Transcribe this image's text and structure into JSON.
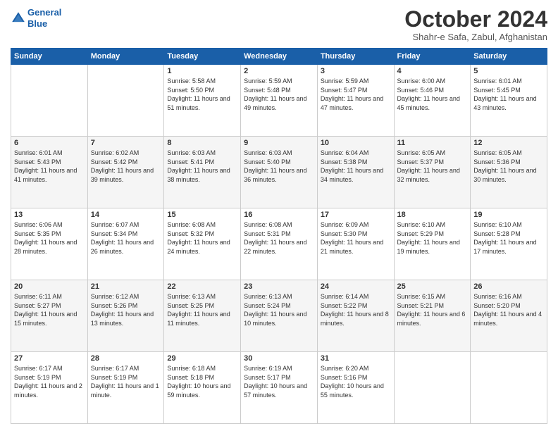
{
  "logo": {
    "line1": "General",
    "line2": "Blue"
  },
  "title": "October 2024",
  "location": "Shahr-e Safa, Zabul, Afghanistan",
  "days_header": [
    "Sunday",
    "Monday",
    "Tuesday",
    "Wednesday",
    "Thursday",
    "Friday",
    "Saturday"
  ],
  "weeks": [
    [
      {
        "num": "",
        "info": ""
      },
      {
        "num": "",
        "info": ""
      },
      {
        "num": "1",
        "info": "Sunrise: 5:58 AM\nSunset: 5:50 PM\nDaylight: 11 hours and 51 minutes."
      },
      {
        "num": "2",
        "info": "Sunrise: 5:59 AM\nSunset: 5:48 PM\nDaylight: 11 hours and 49 minutes."
      },
      {
        "num": "3",
        "info": "Sunrise: 5:59 AM\nSunset: 5:47 PM\nDaylight: 11 hours and 47 minutes."
      },
      {
        "num": "4",
        "info": "Sunrise: 6:00 AM\nSunset: 5:46 PM\nDaylight: 11 hours and 45 minutes."
      },
      {
        "num": "5",
        "info": "Sunrise: 6:01 AM\nSunset: 5:45 PM\nDaylight: 11 hours and 43 minutes."
      }
    ],
    [
      {
        "num": "6",
        "info": "Sunrise: 6:01 AM\nSunset: 5:43 PM\nDaylight: 11 hours and 41 minutes."
      },
      {
        "num": "7",
        "info": "Sunrise: 6:02 AM\nSunset: 5:42 PM\nDaylight: 11 hours and 39 minutes."
      },
      {
        "num": "8",
        "info": "Sunrise: 6:03 AM\nSunset: 5:41 PM\nDaylight: 11 hours and 38 minutes."
      },
      {
        "num": "9",
        "info": "Sunrise: 6:03 AM\nSunset: 5:40 PM\nDaylight: 11 hours and 36 minutes."
      },
      {
        "num": "10",
        "info": "Sunrise: 6:04 AM\nSunset: 5:38 PM\nDaylight: 11 hours and 34 minutes."
      },
      {
        "num": "11",
        "info": "Sunrise: 6:05 AM\nSunset: 5:37 PM\nDaylight: 11 hours and 32 minutes."
      },
      {
        "num": "12",
        "info": "Sunrise: 6:05 AM\nSunset: 5:36 PM\nDaylight: 11 hours and 30 minutes."
      }
    ],
    [
      {
        "num": "13",
        "info": "Sunrise: 6:06 AM\nSunset: 5:35 PM\nDaylight: 11 hours and 28 minutes."
      },
      {
        "num": "14",
        "info": "Sunrise: 6:07 AM\nSunset: 5:34 PM\nDaylight: 11 hours and 26 minutes."
      },
      {
        "num": "15",
        "info": "Sunrise: 6:08 AM\nSunset: 5:32 PM\nDaylight: 11 hours and 24 minutes."
      },
      {
        "num": "16",
        "info": "Sunrise: 6:08 AM\nSunset: 5:31 PM\nDaylight: 11 hours and 22 minutes."
      },
      {
        "num": "17",
        "info": "Sunrise: 6:09 AM\nSunset: 5:30 PM\nDaylight: 11 hours and 21 minutes."
      },
      {
        "num": "18",
        "info": "Sunrise: 6:10 AM\nSunset: 5:29 PM\nDaylight: 11 hours and 19 minutes."
      },
      {
        "num": "19",
        "info": "Sunrise: 6:10 AM\nSunset: 5:28 PM\nDaylight: 11 hours and 17 minutes."
      }
    ],
    [
      {
        "num": "20",
        "info": "Sunrise: 6:11 AM\nSunset: 5:27 PM\nDaylight: 11 hours and 15 minutes."
      },
      {
        "num": "21",
        "info": "Sunrise: 6:12 AM\nSunset: 5:26 PM\nDaylight: 11 hours and 13 minutes."
      },
      {
        "num": "22",
        "info": "Sunrise: 6:13 AM\nSunset: 5:25 PM\nDaylight: 11 hours and 11 minutes."
      },
      {
        "num": "23",
        "info": "Sunrise: 6:13 AM\nSunset: 5:24 PM\nDaylight: 11 hours and 10 minutes."
      },
      {
        "num": "24",
        "info": "Sunrise: 6:14 AM\nSunset: 5:22 PM\nDaylight: 11 hours and 8 minutes."
      },
      {
        "num": "25",
        "info": "Sunrise: 6:15 AM\nSunset: 5:21 PM\nDaylight: 11 hours and 6 minutes."
      },
      {
        "num": "26",
        "info": "Sunrise: 6:16 AM\nSunset: 5:20 PM\nDaylight: 11 hours and 4 minutes."
      }
    ],
    [
      {
        "num": "27",
        "info": "Sunrise: 6:17 AM\nSunset: 5:19 PM\nDaylight: 11 hours and 2 minutes."
      },
      {
        "num": "28",
        "info": "Sunrise: 6:17 AM\nSunset: 5:19 PM\nDaylight: 11 hours and 1 minute."
      },
      {
        "num": "29",
        "info": "Sunrise: 6:18 AM\nSunset: 5:18 PM\nDaylight: 10 hours and 59 minutes."
      },
      {
        "num": "30",
        "info": "Sunrise: 6:19 AM\nSunset: 5:17 PM\nDaylight: 10 hours and 57 minutes."
      },
      {
        "num": "31",
        "info": "Sunrise: 6:20 AM\nSunset: 5:16 PM\nDaylight: 10 hours and 55 minutes."
      },
      {
        "num": "",
        "info": ""
      },
      {
        "num": "",
        "info": ""
      }
    ]
  ]
}
